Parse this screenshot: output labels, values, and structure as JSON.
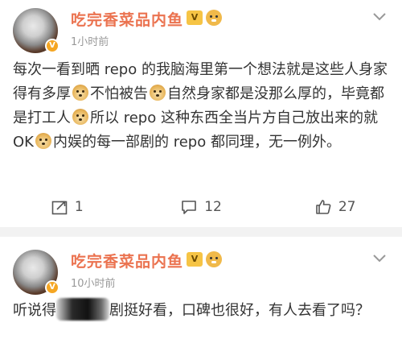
{
  "post1": {
    "username": "吃完香菜品内鱼",
    "time": "1小时前",
    "text_segments": [
      "每次一看到晒 repo 的我脑海里第一个想法就是这些人身家得有多厚",
      "不怕被告",
      "自然身家都是没那么厚的，毕竟都是打工人",
      "所以 repo 这种东西全当片方自己放出来的就 OK",
      "内娱的每一部剧的 repo 都同理，无一例外。"
    ],
    "emoji_icon": "doge-icon",
    "actions": {
      "share_count": "1",
      "comment_count": "12",
      "like_count": "27"
    }
  },
  "post2": {
    "username": "吃完香菜品内鱼",
    "time": "10小时前",
    "text_before": "听说得",
    "text_partial": "剧",
    "text_after": "挺好看，口碑也很好，有人去看了吗？"
  },
  "colors": {
    "username": "#eb7350",
    "time": "#999999",
    "body_text": "#333333",
    "separator": "#f2f2f2"
  },
  "icons": [
    "chevron-down-icon",
    "share-icon",
    "comment-icon",
    "like-icon",
    "verified-badge-icon",
    "member-badge-icon",
    "doge-icon"
  ]
}
